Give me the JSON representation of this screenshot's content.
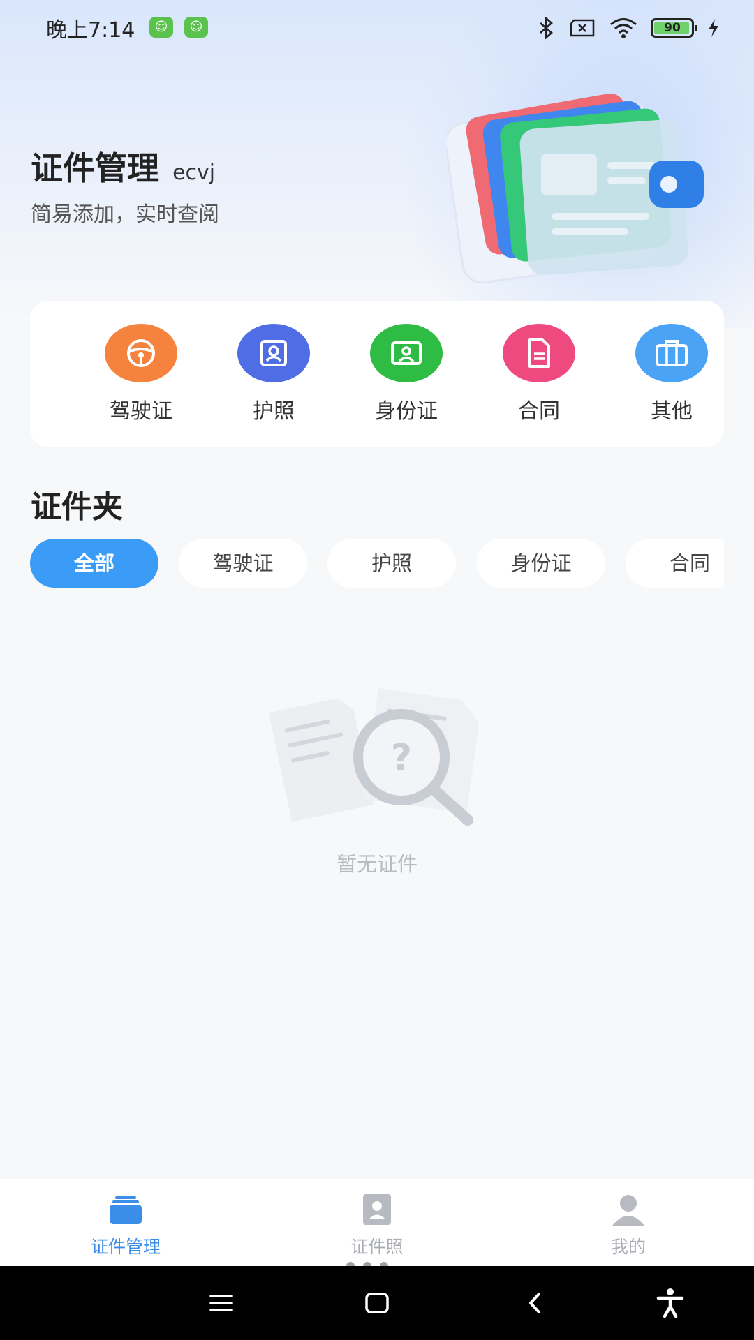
{
  "status_bar": {
    "time": "晚上7:14",
    "battery_level": "90",
    "icons": [
      "bluetooth-icon",
      "sim-off-icon",
      "wifi-icon",
      "battery-icon",
      "charging-icon"
    ]
  },
  "header": {
    "title": "证件管理",
    "title_suffix": "ecvj",
    "subtitle": "简易添加，实时查阅"
  },
  "quick_entries": [
    {
      "label": "驾驶证",
      "icon": "steering-wheel-icon",
      "color": "#f5833e"
    },
    {
      "label": "护照",
      "icon": "portrait-icon",
      "color": "#4f6ee6"
    },
    {
      "label": "身份证",
      "icon": "id-card-icon",
      "color": "#2fbc44"
    },
    {
      "label": "合同",
      "icon": "document-icon",
      "color": "#ef4a7f"
    },
    {
      "label": "其他",
      "icon": "briefcase-icon",
      "color": "#4aa3f5"
    }
  ],
  "folder": {
    "title": "证件夹",
    "filters": [
      "全部",
      "驾驶证",
      "护照",
      "身份证",
      "合同"
    ],
    "selected_filter": "全部",
    "empty_text": "暂无证件"
  },
  "tabbar": {
    "tabs": [
      {
        "label": "证件管理",
        "icon": "card-stack-icon",
        "active": true
      },
      {
        "label": "证件照",
        "icon": "photo-id-icon",
        "active": false
      },
      {
        "label": "我的",
        "icon": "user-icon",
        "active": false
      }
    ],
    "page_indicator": {
      "count": 4,
      "current": 4
    }
  },
  "colors": {
    "accent": "#3b9cf7",
    "tab_active": "#3b8ee8",
    "tab_inactive": "#a9adb3"
  }
}
